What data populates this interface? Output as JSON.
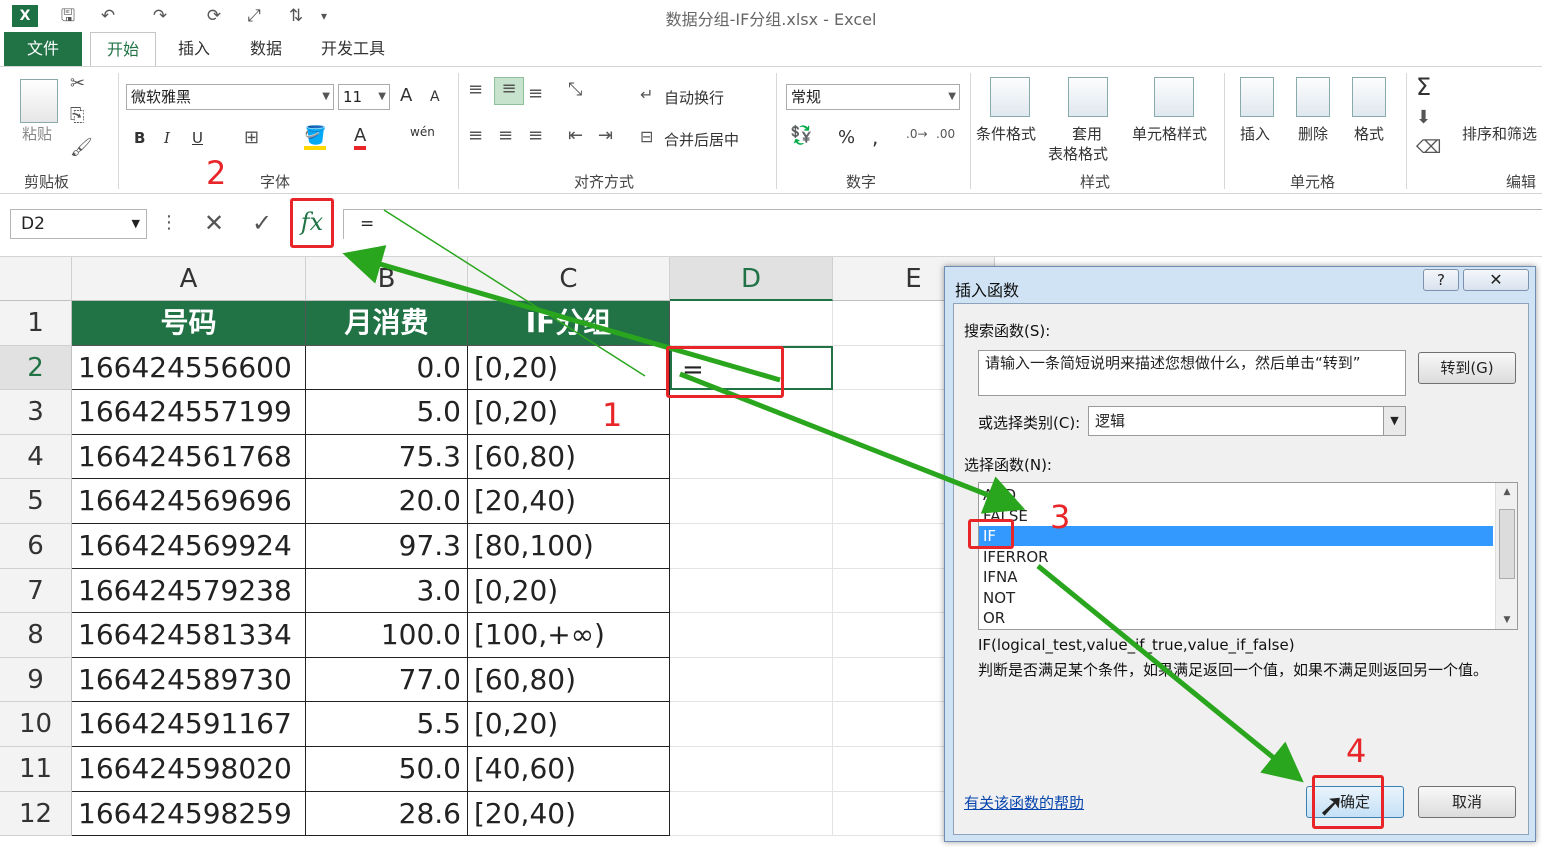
{
  "window": {
    "title": "数据分组-IF分组.xlsx - Excel",
    "app_logo": "X"
  },
  "tabs": [
    {
      "label": "文件"
    },
    {
      "label": "开始"
    },
    {
      "label": "插入"
    },
    {
      "label": "数据"
    },
    {
      "label": "开发工具"
    }
  ],
  "ribbon": {
    "clipboard": {
      "paste": "粘贴",
      "label": "剪贴板"
    },
    "font": {
      "name": "微软雅黑",
      "size": "11",
      "bold": "B",
      "italic": "I",
      "underline": "U",
      "label": "字体",
      "grow": "A",
      "shrink": "A",
      "wen": "wén"
    },
    "align": {
      "wrap": "自动换行",
      "merge": "合并后居中",
      "label": "对齐方式"
    },
    "number": {
      "format": "常规",
      "percent": "%",
      "comma": ",",
      "label": "数字"
    },
    "styles": {
      "conditional": "条件格式",
      "table1": "套用",
      "table2": "表格格式",
      "cell_style": "单元格样式",
      "label": "样式"
    },
    "cells": {
      "insert": "插入",
      "delete": "删除",
      "format": "格式",
      "label": "单元格"
    },
    "editing": {
      "sort": "排序和筛选",
      "label": "编辑",
      "sigma": "Σ"
    }
  },
  "formula_bar": {
    "name_box": "D2",
    "cancel": "✕",
    "enter": "✓",
    "fx": "fx",
    "content": "="
  },
  "grid": {
    "columns": [
      "A",
      "B",
      "C",
      "D",
      "E"
    ],
    "header_row": {
      "a": "号码",
      "b": "月消费",
      "c": "IF分组"
    },
    "rows": [
      {
        "n": "1"
      },
      {
        "n": "2",
        "a": "166424556600",
        "b": "0.0",
        "c": "[0,20)",
        "d": "="
      },
      {
        "n": "3",
        "a": "166424557199",
        "b": "5.0",
        "c": "[0,20)"
      },
      {
        "n": "4",
        "a": "166424561768",
        "b": "75.3",
        "c": "[60,80)"
      },
      {
        "n": "5",
        "a": "166424569696",
        "b": "20.0",
        "c": "[20,40)"
      },
      {
        "n": "6",
        "a": "166424569924",
        "b": "97.3",
        "c": "[80,100)"
      },
      {
        "n": "7",
        "a": "166424579238",
        "b": "3.0",
        "c": "[0,20)"
      },
      {
        "n": "8",
        "a": "166424581334",
        "b": "100.0",
        "c": "[100,+∞)"
      },
      {
        "n": "9",
        "a": "166424589730",
        "b": "77.0",
        "c": "[60,80)"
      },
      {
        "n": "10",
        "a": "166424591167",
        "b": "5.5",
        "c": "[0,20)"
      },
      {
        "n": "11",
        "a": "166424598020",
        "b": "50.0",
        "c": "[40,60)"
      },
      {
        "n": "12",
        "a": "166424598259",
        "b": "28.6",
        "c": "[20,40)"
      }
    ]
  },
  "dialog": {
    "title": "插入函数",
    "help_btn": "?",
    "close_btn": "✕",
    "search_label": "搜索函数(S):",
    "search_text": "请输入一条简短说明来描述您想做什么，然后单击“转到”",
    "go_button": "转到(G)",
    "category_label": "或选择类别(C):",
    "category_value": "逻辑",
    "function_label": "选择函数(N):",
    "functions": [
      "AND",
      "FALSE",
      "IF",
      "IFERROR",
      "IFNA",
      "NOT",
      "OR"
    ],
    "selected_function": "IF",
    "signature": "IF(logical_test,value_if_true,value_if_false)",
    "description": "判断是否满足某个条件，如果满足返回一个值，如果不满足则返回另一个值。",
    "help_link": "有关该函数的帮助",
    "ok_button": "确定",
    "cancel_button": "取消"
  },
  "annotations": {
    "step1": "1",
    "step2": "2",
    "step3": "3",
    "step4": "4",
    "box_color": "#e8262a",
    "arrow_color": "#2aa61e"
  },
  "colors": {
    "excel_green": "#217346",
    "header_fill": "#217346",
    "selection_blue": "#3399ff"
  }
}
